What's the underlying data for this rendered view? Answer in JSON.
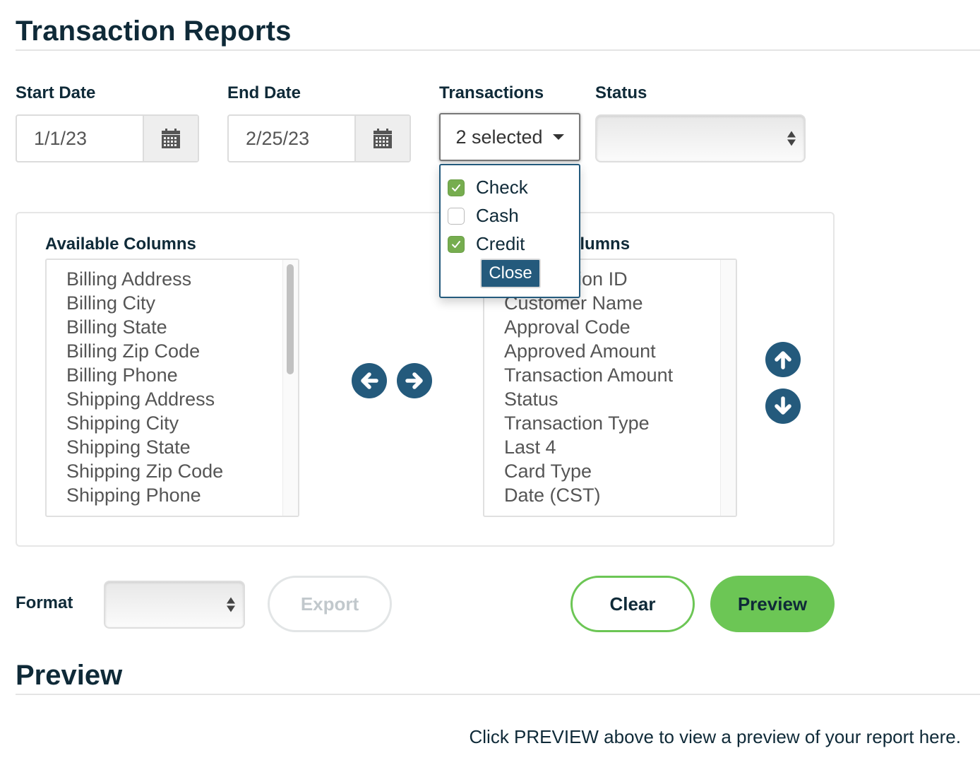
{
  "page": {
    "title": "Transaction Reports",
    "preview_title": "Preview",
    "preview_hint": "Click PREVIEW above to view a preview of your report here."
  },
  "filters": {
    "start_date": {
      "label": "Start Date",
      "value": "1/1/23",
      "icon": "calendar-icon"
    },
    "end_date": {
      "label": "End Date",
      "value": "2/25/23",
      "icon": "calendar-icon"
    },
    "transactions": {
      "label": "Transactions",
      "button_text": "2 selected",
      "options": [
        {
          "label": "Check",
          "checked": true
        },
        {
          "label": "Cash",
          "checked": false
        },
        {
          "label": "Credit",
          "checked": true
        }
      ],
      "close_label": "Close"
    },
    "status": {
      "label": "Status",
      "value": ""
    }
  },
  "columns": {
    "available": {
      "label": "Available Columns",
      "items": [
        "Billing Address",
        "Billing City",
        "Billing State",
        "Billing Zip Code",
        "Billing Phone",
        "Shipping Address",
        "Shipping City",
        "Shipping State",
        "Shipping Zip Code",
        "Shipping Phone"
      ]
    },
    "selected": {
      "label": "Selected Columns",
      "items": [
        "Transaction ID",
        "Customer Name",
        "Approval Code",
        "Approved Amount",
        "Transaction Amount",
        "Status",
        "Transaction Type",
        "Last 4",
        "Card Type",
        "Date (CST)"
      ]
    },
    "move_icons": {
      "left": "arrow-left-circle-icon",
      "right": "arrow-right-circle-icon",
      "up": "arrow-up-circle-icon",
      "down": "arrow-down-circle-icon"
    }
  },
  "actions": {
    "format_label": "Format",
    "format_value": "",
    "export_label": "Export",
    "clear_label": "Clear",
    "preview_label": "Preview"
  },
  "colors": {
    "primary_dark": "#0f2a38",
    "accent_blue": "#245a7c",
    "accent_green": "#6cc655",
    "checkbox_green": "#76ad4f"
  }
}
